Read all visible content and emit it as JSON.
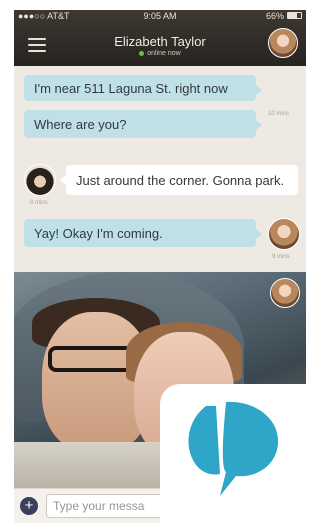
{
  "status_bar": {
    "carrier": "●●●○○ AT&T",
    "time": "9:05 AM",
    "battery": "66%",
    "battery_level": 0.66
  },
  "header": {
    "title": "Elizabeth Taylor",
    "presence": "online now"
  },
  "messages": [
    {
      "text": "I'm near 511 Laguna St. right now"
    },
    {
      "text": "Where are you?",
      "time": "10 mins"
    },
    {
      "text": "Just around the corner. Gonna park.",
      "time": "8 mins"
    },
    {
      "text": "Yay! Okay I'm coming.",
      "time": "9 mins"
    }
  ],
  "composer": {
    "placeholder": "Type your messa"
  },
  "icons": [
    "menu-icon",
    "avatar",
    "plus-icon",
    "app-logo-icon"
  ],
  "colors": {
    "outgoing_bubble": "#bfe0e7",
    "header": "#2f2a26",
    "logo_blue": "#2fa6c8"
  }
}
